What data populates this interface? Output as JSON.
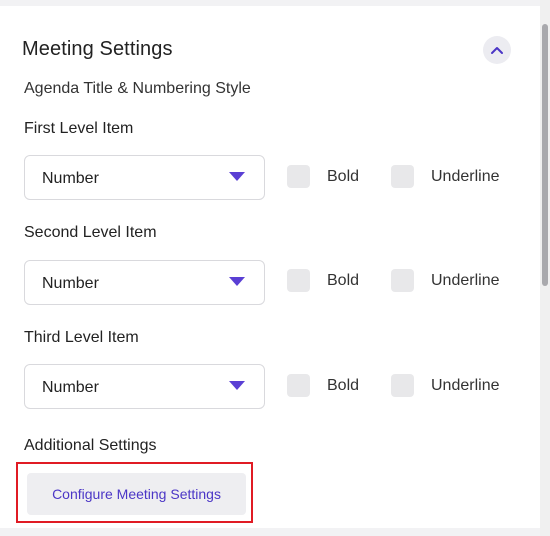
{
  "section": {
    "title": "Meeting Settings",
    "subtitle": "Agenda Title & Numbering Style"
  },
  "levels": [
    {
      "label": "First Level Item",
      "select_value": "Number",
      "bold_label": "Bold",
      "underline_label": "Underline"
    },
    {
      "label": "Second Level Item",
      "select_value": "Number",
      "bold_label": "Bold",
      "underline_label": "Underline"
    },
    {
      "label": "Third Level Item",
      "select_value": "Number",
      "bold_label": "Bold",
      "underline_label": "Underline"
    }
  ],
  "additional": {
    "label": "Additional Settings",
    "button_label": "Configure Meeting Settings"
  },
  "icons": {
    "collapse": "chevron-up-icon",
    "dropdown": "caret-down-icon"
  },
  "colors": {
    "accent": "#5a3fd4",
    "button_text": "#4b36c6",
    "highlight": "#e01b24"
  }
}
